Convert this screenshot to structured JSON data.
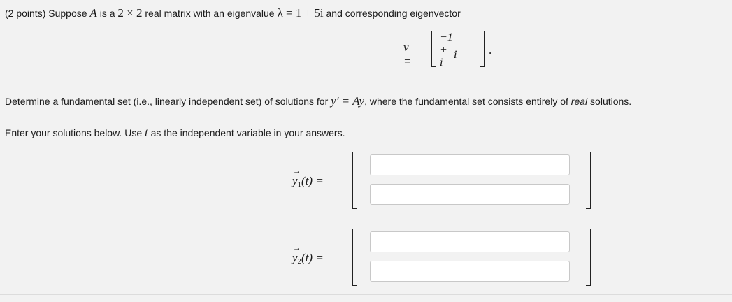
{
  "problem": {
    "points": "(2 points)",
    "intro_pre": "Suppose",
    "matrix_name": "A",
    "intro_mid": "is a",
    "dims": "2 × 2",
    "intro_mid2": "real matrix with an eigenvalue",
    "eigenvalue": "λ = 1 + 5i",
    "intro_post": "and corresponding eigenvector",
    "eigvec_lhs": "v =",
    "eigvec_entries": [
      "−1 + i",
      "i"
    ],
    "task_pre": "Determine a fundamental set (i.e., linearly independent set) of solutions for",
    "ode": "y′ = Ay",
    "task_mid": ", where the fundamental set consists entirely of",
    "task_em": "real",
    "task_post": "solutions.",
    "instr_pre": "Enter your solutions below. Use",
    "var": "t",
    "instr_post": "as the independent variable in your answers."
  },
  "answers": [
    {
      "label": "y",
      "sub": "1",
      "arg": "(t) =",
      "values": [
        "",
        ""
      ]
    },
    {
      "label": "y",
      "sub": "2",
      "arg": "(t) =",
      "values": [
        "",
        ""
      ]
    }
  ]
}
